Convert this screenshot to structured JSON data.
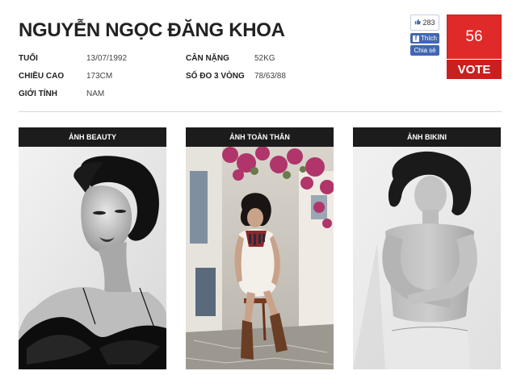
{
  "contestant": {
    "name": "NGUYỄN NGỌC ĐĂNG KHOA"
  },
  "info": {
    "age_label": "TUỔI",
    "age_value": "13/07/1992",
    "height_label": "CHIỀU CAO",
    "height_value": "173CM",
    "gender_label": "GIỚI TÍNH",
    "gender_value": "NAM",
    "weight_label": "CÂN NẶNG",
    "weight_value": "52KG",
    "measurements_label": "SỐ ĐO 3 VÒNG",
    "measurements_value": "78/63/88"
  },
  "social": {
    "like_count": "283",
    "like_label": "Thích",
    "share_label": "Chia sẻ",
    "brand_color": "#4267b2"
  },
  "vote": {
    "count": "56",
    "button_label": "VOTE",
    "color": "#e02a2a"
  },
  "photos": [
    {
      "header": "ẢNH BEAUTY"
    },
    {
      "header": "ẢNH TOÀN THÂN"
    },
    {
      "header": "ẢNH BIKINI"
    }
  ]
}
